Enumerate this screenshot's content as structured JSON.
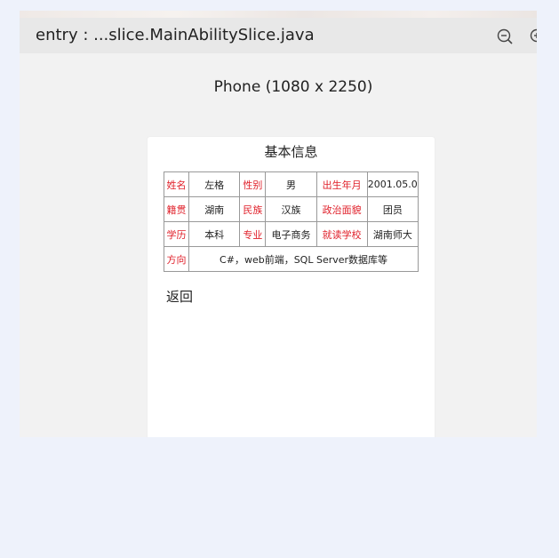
{
  "header": {
    "title": "entry : ...slice.MainAbilitySlice.java",
    "zoom_out_icon": "zoom-out-icon",
    "zoom_in_icon": "zoom-in-icon"
  },
  "device": {
    "label": "Phone (1080 x 2250)"
  },
  "page": {
    "title": "基本信息",
    "back_label": "返回"
  },
  "info_table": {
    "rows": [
      [
        {
          "text": "姓名",
          "kind": "key"
        },
        {
          "text": "左格",
          "kind": "value"
        },
        {
          "text": "性别",
          "kind": "key"
        },
        {
          "text": "男",
          "kind": "value"
        },
        {
          "text": "出生年月",
          "kind": "key"
        },
        {
          "text": "2001.05.01",
          "kind": "value"
        }
      ],
      [
        {
          "text": "籍贯",
          "kind": "key"
        },
        {
          "text": "湖南",
          "kind": "value"
        },
        {
          "text": "民族",
          "kind": "key"
        },
        {
          "text": "汉族",
          "kind": "value"
        },
        {
          "text": "政治面貌",
          "kind": "key"
        },
        {
          "text": "团员",
          "kind": "value"
        }
      ],
      [
        {
          "text": "学历",
          "kind": "key"
        },
        {
          "text": "本科",
          "kind": "value"
        },
        {
          "text": "专业",
          "kind": "key"
        },
        {
          "text": "电子商务",
          "kind": "value"
        },
        {
          "text": "就读学校",
          "kind": "key"
        },
        {
          "text": "湖南师大",
          "kind": "value"
        }
      ],
      [
        {
          "text": "方向",
          "kind": "key"
        },
        {
          "text": "C#，web前端，SQL Server数据库等",
          "kind": "value",
          "colspan": 5
        }
      ]
    ]
  },
  "colors": {
    "key_text": "#e0202a",
    "value_text": "#222222",
    "panel_bg": "#f2f2f2",
    "page_bg": "#eef2fb"
  }
}
